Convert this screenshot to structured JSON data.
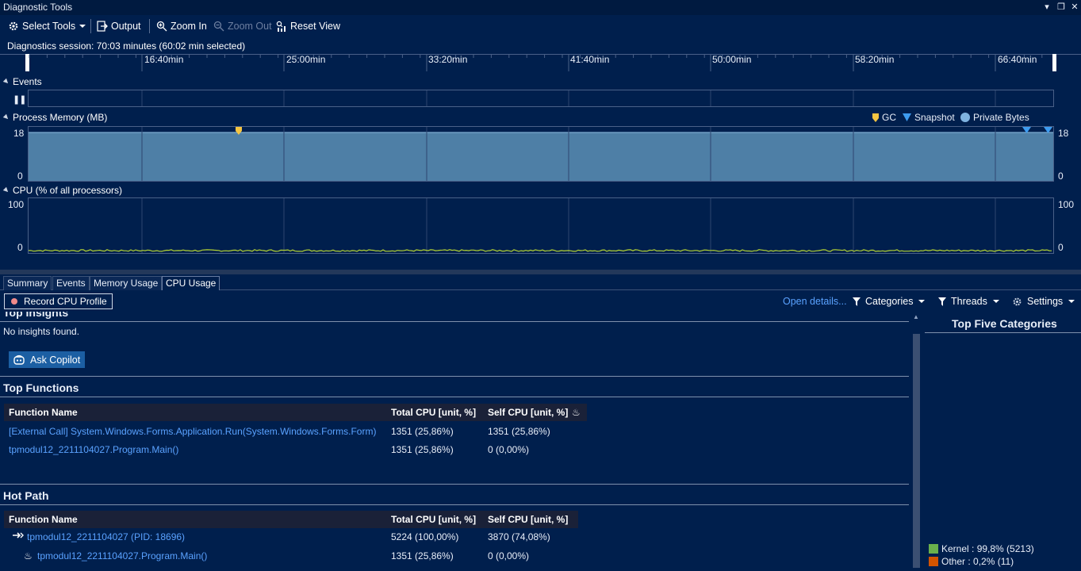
{
  "window": {
    "title": "Diagnostic Tools"
  },
  "toolbar": {
    "select_tools": "Select Tools",
    "output": "Output",
    "zoom_in": "Zoom In",
    "zoom_out": "Zoom Out",
    "reset_view": "Reset View"
  },
  "session": {
    "text": "Diagnostics session: 70:03 minutes (60:02 min selected)"
  },
  "ruler": {
    "ticks": [
      "16:40min",
      "25:00min",
      "33:20min",
      "41:40min",
      "50:00min",
      "58:20min",
      "66:40min"
    ]
  },
  "events": {
    "heading": "Events"
  },
  "memory": {
    "heading": "Process Memory (MB)",
    "axis_max": "18",
    "axis_min": "0",
    "legend": {
      "gc": "GC",
      "snapshot": "Snapshot",
      "private_bytes": "Private Bytes"
    },
    "colors": {
      "fill": "#4e7fa6",
      "gc_marker": "#f5c542",
      "snapshot_marker": "#3d9cf0",
      "private_bytes": "#7fb3e0"
    }
  },
  "cpu": {
    "heading": "CPU (% of all processors)",
    "axis_max": "100",
    "axis_min": "0",
    "line_color": "#b5d334"
  },
  "tabs": [
    {
      "label": "Summary",
      "active": false
    },
    {
      "label": "Events",
      "active": false
    },
    {
      "label": "Memory Usage",
      "active": false
    },
    {
      "label": "CPU Usage",
      "active": true
    }
  ],
  "actions": {
    "record_cpu_profile": "Record CPU Profile",
    "open_details": "Open details...",
    "categories": "Categories",
    "threads": "Threads",
    "settings": "Settings"
  },
  "insights": {
    "heading": "Top Insights",
    "empty_text": "No insights found.",
    "ask_copilot": "Ask Copilot"
  },
  "top_functions": {
    "heading": "Top Functions",
    "columns": [
      "Function Name",
      "Total CPU [unit, %]",
      "Self CPU [unit, %]"
    ],
    "rows": [
      {
        "name": "[External Call] System.Windows.Forms.Application.Run(System.Windows.Forms.Form)",
        "total": "1351 (25,86%)",
        "self": "1351 (25,86%)"
      },
      {
        "name": "tpmodul12_2211104027.Program.Main()",
        "total": "1351 (25,86%)",
        "self": "0 (0,00%)"
      }
    ]
  },
  "hot_path": {
    "heading": "Hot Path",
    "columns": [
      "Function Name",
      "Total CPU [unit, %]",
      "Self CPU [unit, %]"
    ],
    "rows": [
      {
        "name": "tpmodul12_2211104027 (PID: 18696)",
        "total": "5224 (100,00%)",
        "self": "3870 (74,08%)",
        "icon": "hot-path-icon"
      },
      {
        "name": "tpmodul12_2211104027.Program.Main()",
        "total": "1351 (25,86%)",
        "self": "0 (0,00%)",
        "icon": "flame-icon"
      }
    ]
  },
  "top_five": {
    "title": "Top Five Categories",
    "items": [
      {
        "label": "Kernel : 99,8% (5213)",
        "color": "#6ab04c"
      },
      {
        "label": "Other : 0,2% (11)",
        "color": "#d35400"
      }
    ]
  }
}
